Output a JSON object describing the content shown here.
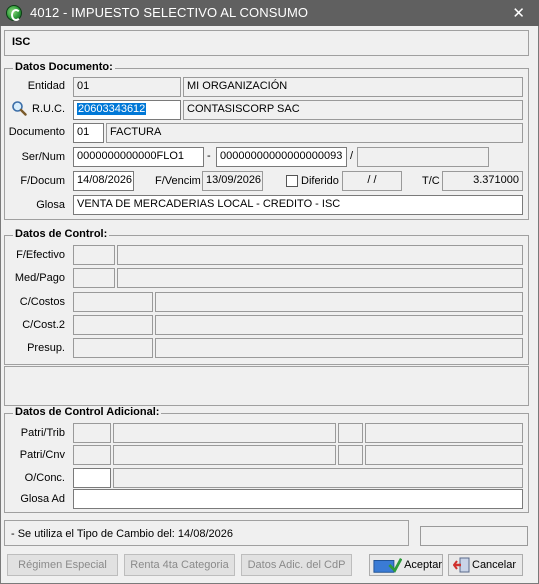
{
  "window": {
    "title": "4012 - IMPUESTO SELECTIVO AL CONSUMO",
    "close_glyph": "✕",
    "header_code": "ISC"
  },
  "datos_documento": {
    "legend": "Datos Documento:",
    "entidad_label": "Entidad",
    "entidad_code": "01",
    "entidad_name": "MI ORGANIZACIÓN",
    "ruc_label": "R.U.C.",
    "ruc_value": "20603343612",
    "ruc_name": "CONTASISCORP SAC",
    "documento_label": "Documento",
    "documento_code": "01",
    "documento_name": "FACTURA",
    "sernum_label": "Ser/Num",
    "serie_value": "0000000000000FLO1",
    "dash": "-",
    "numero_value": "00000000000000000093",
    "slash": "/",
    "fdocum_label": "F/Docum",
    "fdocum_value": "14/08/2026",
    "fvencim_label": "F/Vencim",
    "fvencim_value": "13/09/2026",
    "diferido_label": "Diferido",
    "diferido_value": "/ /",
    "tc_label": "T/C",
    "tc_value": "3.371000",
    "glosa_label": "Glosa",
    "glosa_value": "VENTA DE MERCADERIAS LOCAL - CREDITO - ISC"
  },
  "datos_control": {
    "legend": "Datos de Control:",
    "fefectivo_label": "F/Efectivo",
    "medpago_label": "Med/Pago",
    "ccostos_label": "C/Costos",
    "ccost2_label": "C/Cost.2",
    "presup_label": "Presup."
  },
  "datos_control_adicional": {
    "legend": "Datos de Control Adicional:",
    "patritrib_label": "Patri/Trib",
    "patricnv_label": "Patri/Cnv",
    "oconc_label": "O/Conc.",
    "glosaad_label": "Glosa Ad"
  },
  "status": {
    "message": "- Se utiliza el Tipo de Cambio del: 14/08/2026"
  },
  "buttons": {
    "regimen": "Régimen Especial",
    "renta": "Renta 4ta Categoria",
    "datos_adic": "Datos Adic. del CdP",
    "aceptar": "Aceptar",
    "cancelar": "Cancelar"
  },
  "icons": {
    "app": "app-logo-icon",
    "search": "magnifier-icon",
    "aceptar": "check-icon",
    "cancelar": "exit-door-icon"
  }
}
